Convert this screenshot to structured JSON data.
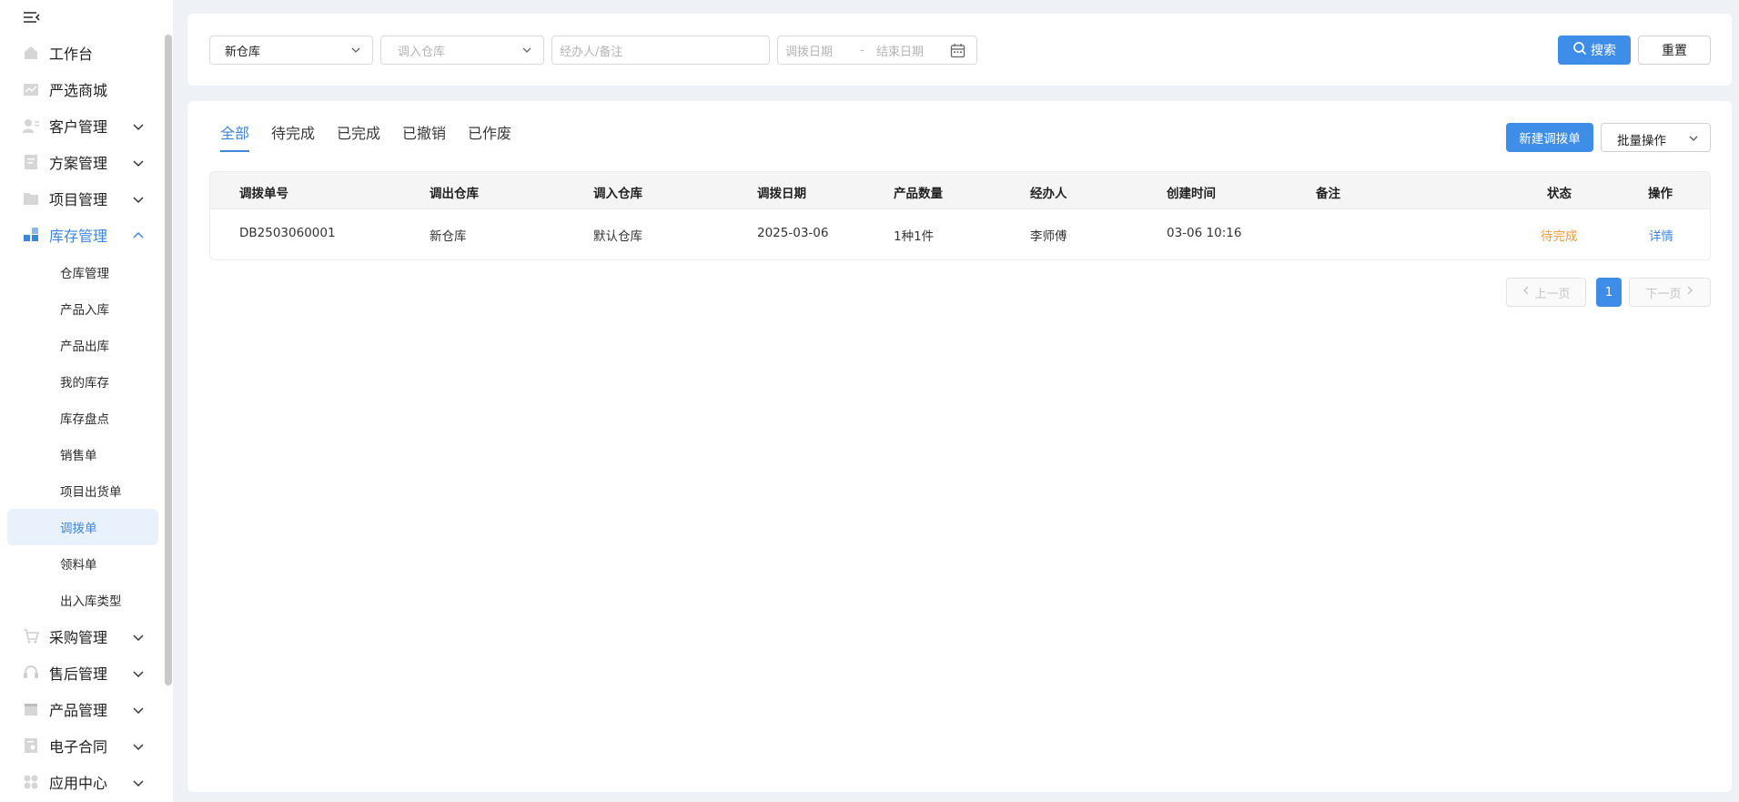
{
  "sidebar": {
    "collapse_icon": "menu-fold-icon",
    "items": [
      {
        "label": "工作台",
        "icon": "home-icon",
        "has_children": false
      },
      {
        "label": "严选商城",
        "icon": "store-icon",
        "has_children": false
      },
      {
        "label": "客户管理",
        "icon": "customer-icon",
        "has_children": true,
        "expanded": false
      },
      {
        "label": "方案管理",
        "icon": "plan-icon",
        "has_children": true,
        "expanded": false
      },
      {
        "label": "项目管理",
        "icon": "folder-icon",
        "has_children": true,
        "expanded": false
      },
      {
        "label": "库存管理",
        "icon": "inventory-icon",
        "has_children": true,
        "expanded": true
      },
      {
        "label": "采购管理",
        "icon": "cart-icon",
        "has_children": true,
        "expanded": false
      },
      {
        "label": "售后管理",
        "icon": "headset-icon",
        "has_children": true,
        "expanded": false
      },
      {
        "label": "产品管理",
        "icon": "product-icon",
        "has_children": true,
        "expanded": false
      },
      {
        "label": "电子合同",
        "icon": "contract-icon",
        "has_children": true,
        "expanded": false
      },
      {
        "label": "应用中心",
        "icon": "apps-icon",
        "has_children": true,
        "expanded": false
      }
    ],
    "inventory_sub": [
      {
        "label": "仓库管理"
      },
      {
        "label": "产品入库"
      },
      {
        "label": "产品出库"
      },
      {
        "label": "我的库存"
      },
      {
        "label": "库存盘点"
      },
      {
        "label": "销售单"
      },
      {
        "label": "项目出货单"
      },
      {
        "label": "调拨单",
        "selected": true
      },
      {
        "label": "领料单"
      },
      {
        "label": "出入库类型"
      }
    ]
  },
  "search": {
    "out_warehouse_value": "新仓库",
    "in_warehouse_placeholder": "调入仓库",
    "keyword_placeholder": "经办人/备注",
    "date_start_placeholder": "调拨日期",
    "date_separator": "-",
    "date_end_placeholder": "结束日期",
    "search_label": "搜索",
    "reset_label": "重置"
  },
  "tabs": [
    "全部",
    "待完成",
    "已完成",
    "已撤销",
    "已作废"
  ],
  "active_tab": "全部",
  "actions": {
    "new_label": "新建调拨单",
    "batch_label": "批量操作"
  },
  "table": {
    "columns": [
      "调拨单号",
      "调出仓库",
      "调入仓库",
      "调拨日期",
      "产品数量",
      "经办人",
      "创建时间",
      "备注",
      "状态",
      "操作"
    ],
    "rows": [
      {
        "no": "DB2503060001",
        "out_wh": "新仓库",
        "in_wh": "默认仓库",
        "date": "2025-03-06",
        "qty": "1种1件",
        "handler": "李师傅",
        "created": "03-06 10:16",
        "remark": "",
        "status": "待完成",
        "op": "详情"
      }
    ]
  },
  "pager": {
    "prev_label": "上一页",
    "current": "1",
    "next_label": "下一页"
  },
  "colors": {
    "accent": "#3e8ee9",
    "status_pending": "#f09b3a",
    "sidebar_selected_bg": "#e9f1fc"
  }
}
